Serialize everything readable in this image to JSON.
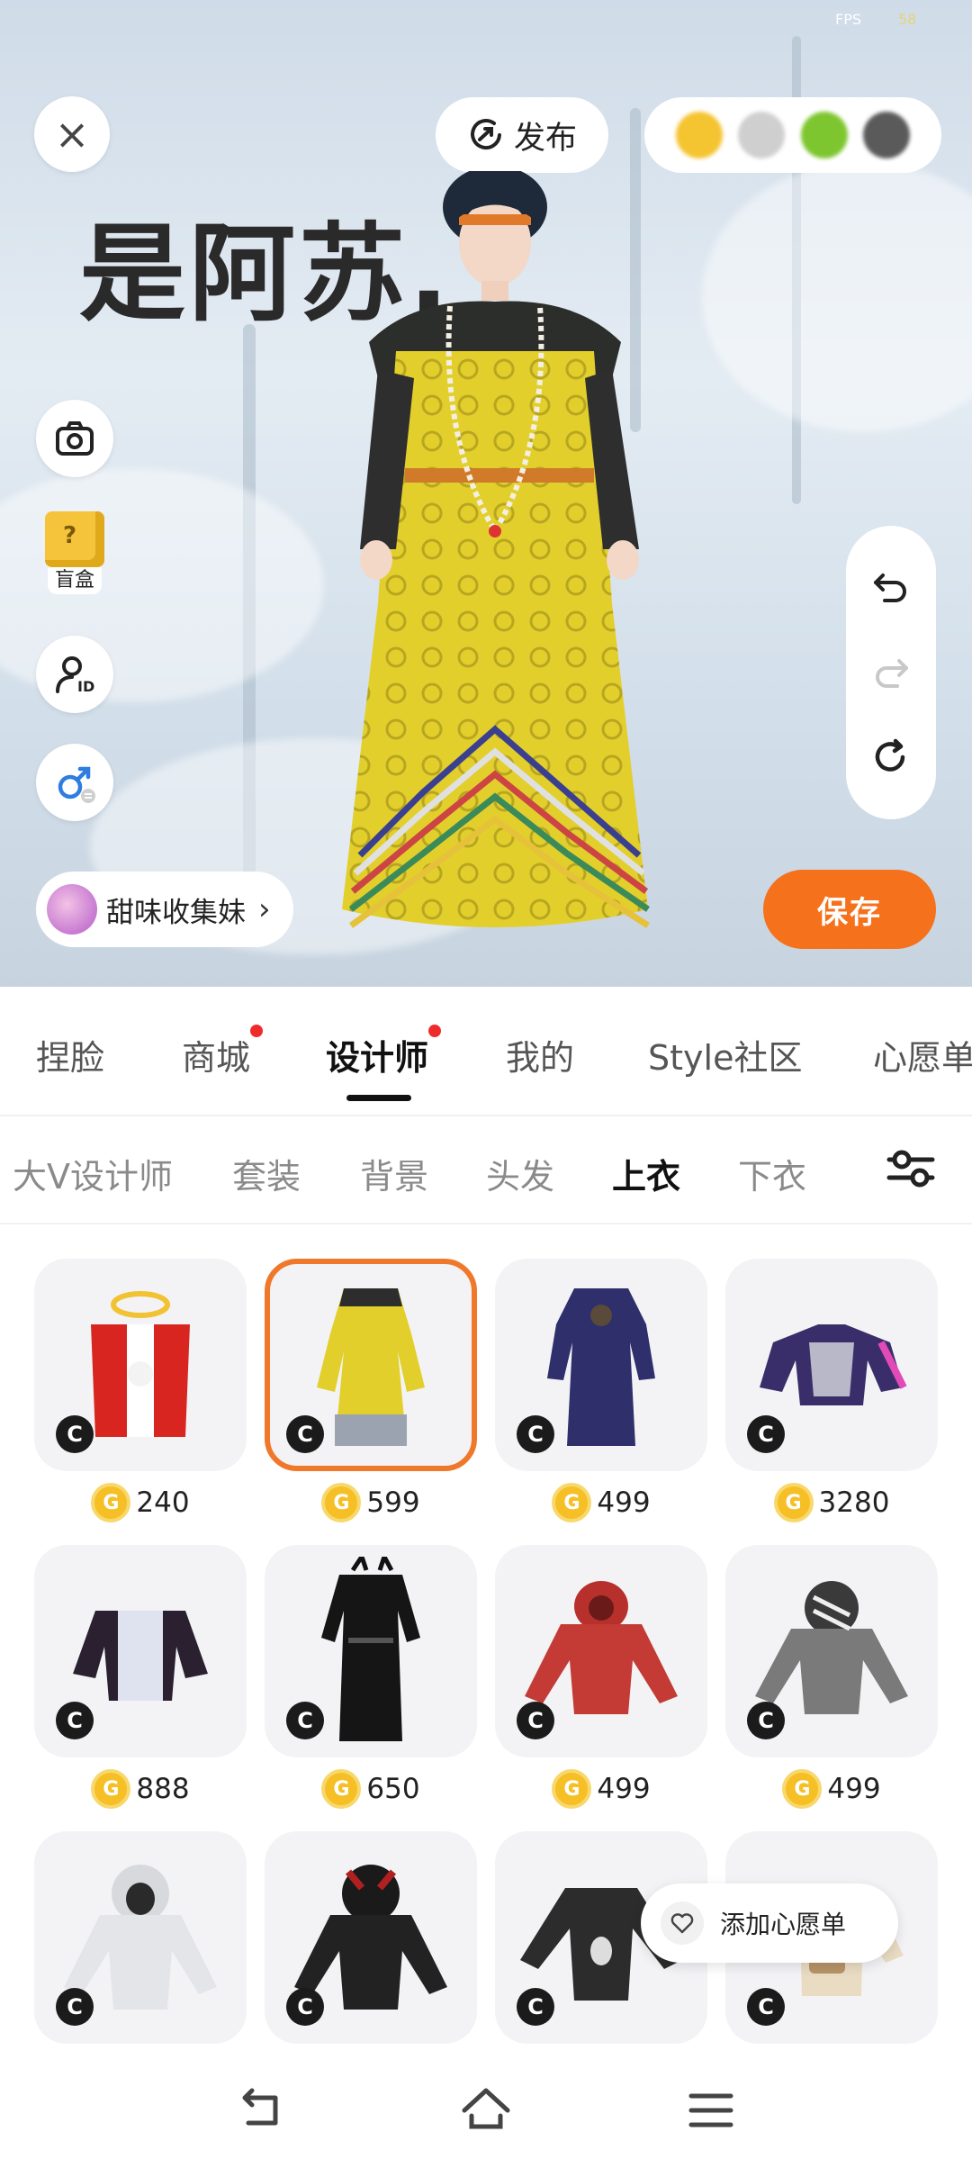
{
  "status": {
    "fps_label": "FPS",
    "fps_value": "58"
  },
  "stage": {
    "close_icon": "close-icon",
    "publish_label": "发布",
    "user_name": "是阿苏.",
    "blindbox_label": "盲盒",
    "creator_name": "甜味收集妹",
    "save_label": "保存",
    "swatch_colors": [
      "#f5c431",
      "#c9c9c9",
      "#7ec62f",
      "#555555"
    ]
  },
  "main_tabs": [
    {
      "label": "捏脸",
      "dot": false
    },
    {
      "label": "商城",
      "dot": true
    },
    {
      "label": "设计师",
      "dot": true,
      "active": true
    },
    {
      "label": "我的",
      "dot": false
    },
    {
      "label": "Style社区",
      "dot": false
    },
    {
      "label": "心愿单",
      "dot": false
    }
  ],
  "sub_tabs": [
    {
      "label": "大V设计师"
    },
    {
      "label": "套装"
    },
    {
      "label": "背景"
    },
    {
      "label": "头发"
    },
    {
      "label": "上衣",
      "active": true
    },
    {
      "label": "下衣"
    }
  ],
  "items": [
    {
      "name": "red-cape",
      "price": "240",
      "selected": false
    },
    {
      "name": "yellow-dragon-robe",
      "price": "599",
      "selected": true
    },
    {
      "name": "navy-long-robe",
      "price": "499",
      "selected": false
    },
    {
      "name": "mech-armor-top",
      "price": "3280",
      "selected": false
    },
    {
      "name": "holo-jacket",
      "price": "888",
      "selected": false
    },
    {
      "name": "black-coat",
      "price": "650",
      "selected": false
    },
    {
      "name": "red-hoodie",
      "price": "499",
      "selected": false
    },
    {
      "name": "zebra-hoodie",
      "price": "499",
      "selected": false
    },
    {
      "name": "grey-hoodie",
      "price": "",
      "selected": false
    },
    {
      "name": "black-hoodie",
      "price": "",
      "selected": false
    },
    {
      "name": "dark-sweater",
      "price": "",
      "selected": false
    },
    {
      "name": "beige-top",
      "price": "",
      "selected": false
    }
  ],
  "badge_label": "C",
  "coin_label": "G",
  "wish_popup_label": "添加心愿单",
  "colors": {
    "accent": "#f6711b",
    "dot": "#ef2b2b",
    "coin": "#f5bf25"
  }
}
